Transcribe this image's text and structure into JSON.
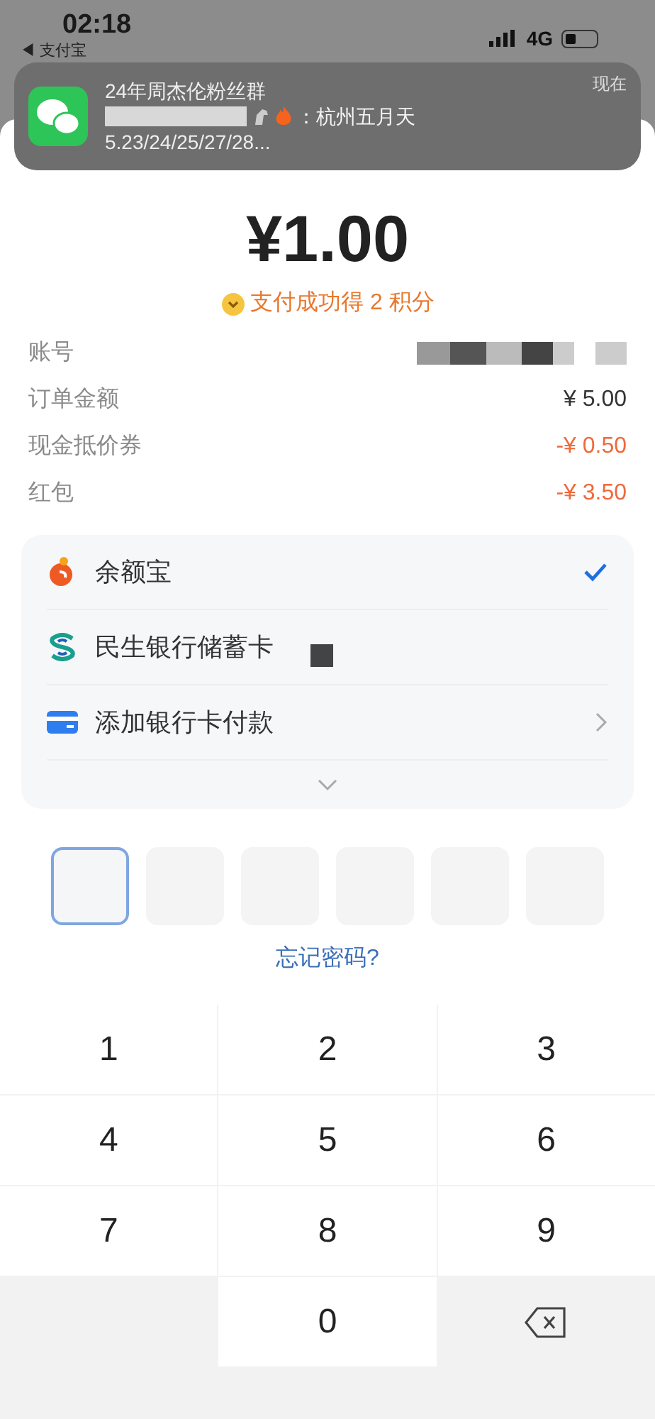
{
  "status_bar": {
    "time": "02:18",
    "back_app": "◀ 支付宝",
    "network": "4G"
  },
  "notification": {
    "title": "24年周杰伦粉丝群",
    "message": "：杭州五月天",
    "preview": "5.23/24/25/27/28...",
    "time": "现在"
  },
  "payment": {
    "amount": "¥1.00",
    "reward": "支付成功得 2 积分",
    "details": [
      {
        "label": "账号",
        "masked": true
      },
      {
        "label": "订单金额",
        "value": "¥ 5.00",
        "kind": "plain"
      },
      {
        "label": "现金抵价券",
        "value": "-¥ 0.50",
        "kind": "discount"
      },
      {
        "label": "红包",
        "value": "-¥ 3.50",
        "kind": "discount"
      }
    ]
  },
  "methods": [
    {
      "label": "余额宝",
      "kind": "fund",
      "selected": true
    },
    {
      "label": "民生银行储蓄卡",
      "kind": "bank",
      "selected": false
    },
    {
      "label": "添加银行卡付款",
      "kind": "add",
      "selected": false
    }
  ],
  "pin": [
    {
      "focused": true
    },
    {
      "focused": false
    },
    {
      "focused": false
    },
    {
      "focused": false
    },
    {
      "focused": false
    },
    {
      "focused": false
    }
  ],
  "forgot": "忘记密码?",
  "keypad": [
    "1",
    "2",
    "3",
    "4",
    "5",
    "6",
    "7",
    "8",
    "9",
    "0"
  ]
}
